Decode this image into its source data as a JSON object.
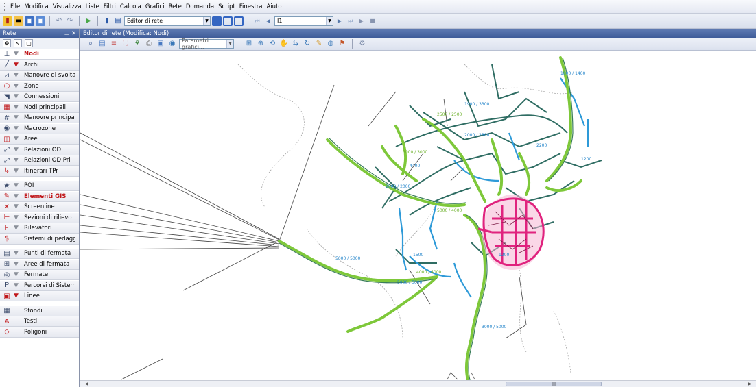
{
  "menu": [
    "File",
    "Modifica",
    "Visualizza",
    "Liste",
    "Filtri",
    "Calcola",
    "Grafici",
    "Rete",
    "Domanda",
    "Script",
    "Finestra",
    "Aiuto"
  ],
  "toolbar": {
    "mode_select": "Editor di rete",
    "scenario_select": "I1"
  },
  "left_panel": {
    "title": "Rete",
    "pin_close": "  ⊥ ✕",
    "layers": [
      {
        "label": "Nodi",
        "icon": "node-icon",
        "filter": "inactive",
        "style": "selected"
      },
      {
        "label": "Archi",
        "icon": "link-icon",
        "filter": "active",
        "style": ""
      },
      {
        "label": "Manovre di svolta",
        "icon": "turn-icon",
        "filter": "inactive",
        "style": ""
      },
      {
        "label": "Zone",
        "icon": "zone-icon",
        "filter": "inactive",
        "style": ""
      },
      {
        "label": "Connessioni",
        "icon": "connector-icon",
        "filter": "inactive",
        "style": ""
      },
      {
        "label": "Nodi principali",
        "icon": "main-node-icon",
        "filter": "inactive",
        "style": ""
      },
      {
        "label": "Manovre principali",
        "icon": "main-turn-icon",
        "filter": "inactive",
        "style": ""
      },
      {
        "label": "Macrozone",
        "icon": "macrozone-icon",
        "filter": "inactive",
        "style": ""
      },
      {
        "label": "Aree",
        "icon": "area-icon",
        "filter": "inactive",
        "style": ""
      },
      {
        "label": "Relazioni OD",
        "icon": "od-icon",
        "filter": "inactive",
        "style": ""
      },
      {
        "label": "Relazioni OD Pri",
        "icon": "od-main-icon",
        "filter": "inactive",
        "style": ""
      },
      {
        "label": "Itinerari TPr",
        "icon": "route-icon",
        "filter": "inactive",
        "style": ""
      },
      {
        "label": "POI",
        "icon": "star-icon",
        "filter": "inactive",
        "style": "gap"
      },
      {
        "label": "Elementi GIS",
        "icon": "gis-icon",
        "filter": "inactive",
        "style": "red"
      },
      {
        "label": "Screenline",
        "icon": "screenline-icon",
        "filter": "inactive",
        "style": ""
      },
      {
        "label": "Sezioni di rilievo",
        "icon": "count-icon",
        "filter": "inactive",
        "style": ""
      },
      {
        "label": "Rilevatori",
        "icon": "detector-icon",
        "filter": "inactive",
        "style": ""
      },
      {
        "label": "Sistemi di pedaggio",
        "icon": "toll-icon",
        "filter": "none",
        "style": ""
      },
      {
        "label": "Punti di fermata",
        "icon": "stop-point-icon",
        "filter": "inactive",
        "style": "gap"
      },
      {
        "label": "Aree di fermata",
        "icon": "stop-area-icon",
        "filter": "inactive",
        "style": ""
      },
      {
        "label": "Fermate",
        "icon": "stop-icon",
        "filter": "inactive",
        "style": ""
      },
      {
        "label": "Percorsi di Sistema",
        "icon": "system-route-icon",
        "filter": "inactive",
        "style": ""
      },
      {
        "label": "Linee",
        "icon": "line-icon",
        "filter": "active",
        "style": ""
      },
      {
        "label": "Sfondi",
        "icon": "background-icon",
        "filter": "none",
        "style": "gap"
      },
      {
        "label": "Testi",
        "icon": "text-icon",
        "filter": "none",
        "style": ""
      },
      {
        "label": "Poligoni",
        "icon": "polygon-icon",
        "filter": "none",
        "style": ""
      }
    ]
  },
  "editor": {
    "title": "Editor di rete (Modifica: Nodi)",
    "graphics_select": "Parametri grafici..."
  },
  "colors": {
    "title_bar": "#4a67a3",
    "flow_green": "#7ec83a",
    "flow_dark": "#3a7d5a",
    "flow_blue": "#2e9ad8",
    "center_pink": "#e0237e",
    "label_blue": "#1f82c9",
    "label_green": "#6cb12a"
  },
  "map_labels": [
    "5000 / 5000",
    "5000 / 5000",
    "4000 / 4000",
    "2500 / 2500",
    "2000 / 2800",
    "3000 / 3000",
    "1500",
    "1200",
    "2000 / 2000",
    "4400",
    "5000 / 4000",
    "1800 / 1400",
    "1900 / 3300",
    "3000 / 5000",
    "2200",
    "1200"
  ]
}
